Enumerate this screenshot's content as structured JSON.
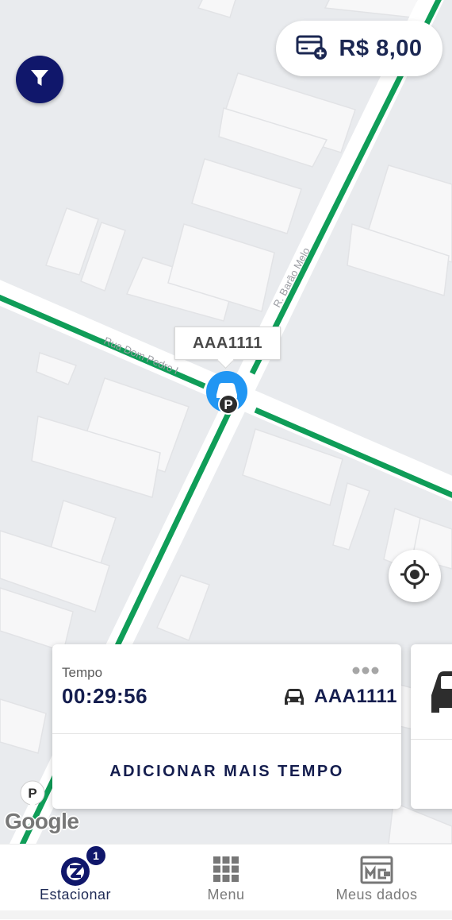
{
  "balance": {
    "amount": "R$ 8,00",
    "icon": "credit-card-add-icon"
  },
  "map": {
    "streets": [
      "Rua Dom Pedro I",
      "R. Barão Melo"
    ],
    "selected_plate": "AAA1111",
    "road_color": "#0f9d58",
    "attribution": "Google"
  },
  "session": {
    "time_label": "Tempo",
    "time_value": "00:29:56",
    "plate": "AAA1111",
    "action": "ADICIONAR MAIS TEMPO"
  },
  "nav": {
    "items": [
      {
        "label": "Estacionar",
        "icon": "zul-logo-icon",
        "badge": "1",
        "active": true
      },
      {
        "label": "Menu",
        "icon": "grid-icon",
        "active": false
      },
      {
        "label": "Meus dados",
        "icon": "id-card-icon",
        "active": false
      }
    ]
  },
  "colors": {
    "primary": "#10176b",
    "text_dark": "#141d4e",
    "road": "#0f9d58",
    "pin": "#2196f3"
  }
}
